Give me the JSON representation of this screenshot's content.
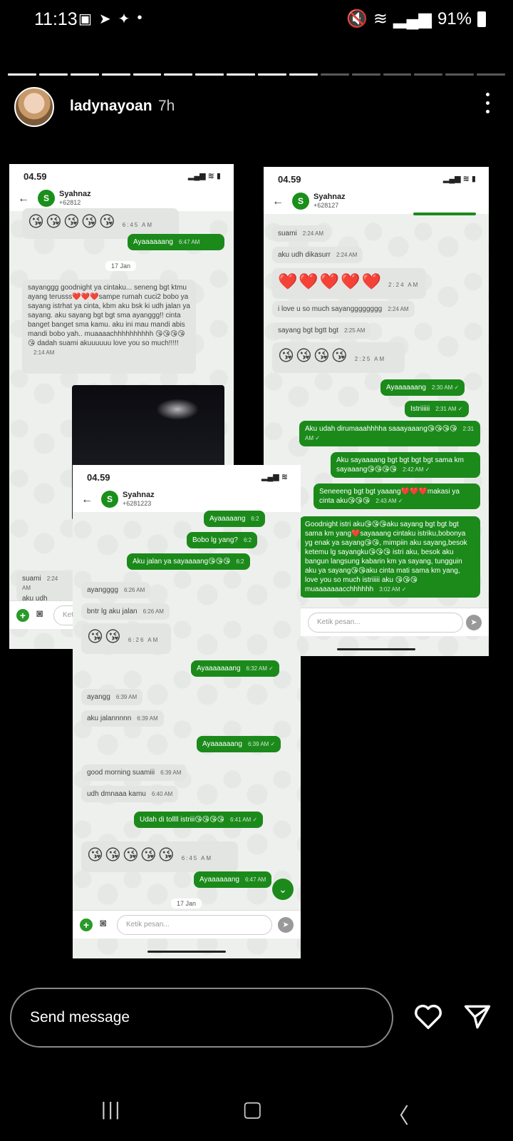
{
  "status_bar": {
    "time": "11:13",
    "battery": "91%"
  },
  "story": {
    "username": "ladynayoan",
    "age": "7h",
    "progress_total": 16,
    "progress_done": 10
  },
  "shot_left": {
    "phone_time": "04.59",
    "contact_name": "Syahnaz",
    "contact_number": "+62812",
    "emoji_row": "😘😘😘😘😘",
    "emoji_time": "6:45 AM",
    "out1": "Ayaaaaaang",
    "out1_time": "6:47 AM",
    "date": "17 Jan",
    "long_msg": "sayanggg goodnight ya cintaku... seneng bgt ktmu ayang terusss❤️❤️❤️sampe rumah cuci2 bobo ya sayang istrhat ya cinta, kbm aku bsk ki udh jalan ya sayang. aku sayang bgt bgt sma ayanggg!! cinta banget banget sma kamu. aku ini mau mandi abis mandi bobo yah.. muaaaachhhhhhhhhh 😘😘😘😘😘 dadah suami akuuuuuu love you so much!!!!!",
    "long_time": "2:14 AM",
    "in_suami": "suami",
    "in_suami_time": "2:24 AM",
    "in_cut": "aku udh dikasurr",
    "placeholder": "Ketik"
  },
  "shot_right": {
    "phone_time": "04.59",
    "contact_name": "Syahnaz",
    "contact_number": "+628127",
    "m1": "suami",
    "m1_time": "2:24 AM",
    "m2": "aku udh dikasurr",
    "m2_time": "2:24 AM",
    "m3": "❤️❤️❤️❤️❤️",
    "m3_time": "2:24 AM",
    "m4": "i love u so much sayangggggggg",
    "m4_time": "2:24 AM",
    "m5": "sayang bgt bgtt bgt",
    "m5_time": "2:25 AM",
    "m6": "😘😘😘😘",
    "m6_time": "2:25 AM",
    "o1": "Ayaaaaaang",
    "o1_time": "2:30 AM ✓",
    "o2": "Istriiiiii",
    "o2_time": "2:31 AM ✓",
    "o3": "Aku udah dirumaaahhhha saaayaaang😘😘😘😘",
    "o3_time": "2:31 AM ✓",
    "o4": "Aku sayaaaang bgt bgt bgt bgt sama km sayaaang😘😘😘😘",
    "o4_time": "2:42 AM ✓",
    "o5": "Seneeeng bgt bgt yaaang❤️❤️❤️makasi ya cinta aku😘😘😘",
    "o5_time": "2:43 AM ✓",
    "o6": "Goodnight istri aku😘😘😘aku sayang bgt bgt bgt sama km yang❤️sayaaang cintaku istriku,bobonya yg enak ya sayang😘😘, mimpiin aku sayang,besok ketemu lg sayangku😘😘😘 istri aku, besok aku bangun langsung kabarin km ya sayang, tungguin aku ya sayang😘😘aku cinta mati sama km yang, love you so much istriiiii aku 😘😘😘muaaaaaaacchhhhhh",
    "o6_time": "3:02 AM ✓",
    "placeholder": "Ketik pesan..."
  },
  "shot_mid": {
    "phone_time": "04.59",
    "contact_name": "Syahnaz",
    "contact_number": "+6281223",
    "o1": "Ayaaaaang",
    "o1_time": "6:2",
    "o2": "Bobo lg yang?",
    "o2_time": "6:2",
    "o3": "Aku jalan ya sayaaaang😘😘😘",
    "o3_time": "6:2",
    "i1": "ayangggg",
    "i1_time": "6:26 AM",
    "i2": "bntr lg aku jalan",
    "i2_time": "6:26 AM",
    "i3": "😘😘",
    "i3_time": "6:26 AM",
    "o4": "Ayaaaaaaang",
    "o4_time": "6:32 AM ✓",
    "i4": "ayangg",
    "i4_time": "6:39 AM",
    "i5": "aku jalannnnn",
    "i5_time": "6:39 AM",
    "o5": "Ayaaaaaang",
    "o5_time": "6:39 AM ✓",
    "i6": "good morning suamiii",
    "i6_time": "6:39 AM",
    "i7": "udh dmnaaa kamu",
    "i7_time": "6:40 AM",
    "o6": "Udah di tollll istriii😘😘😘😘",
    "o6_time": "6:41 AM ✓",
    "i8": "😘😘😘😘😘",
    "i8_time": "6:45 AM",
    "o7": "Ayaaaaaang",
    "o7_time": "6:47 AM",
    "date": "17 Jan",
    "placeholder": "Ketik pesan..."
  },
  "bottom": {
    "send_placeholder": "Send message"
  }
}
